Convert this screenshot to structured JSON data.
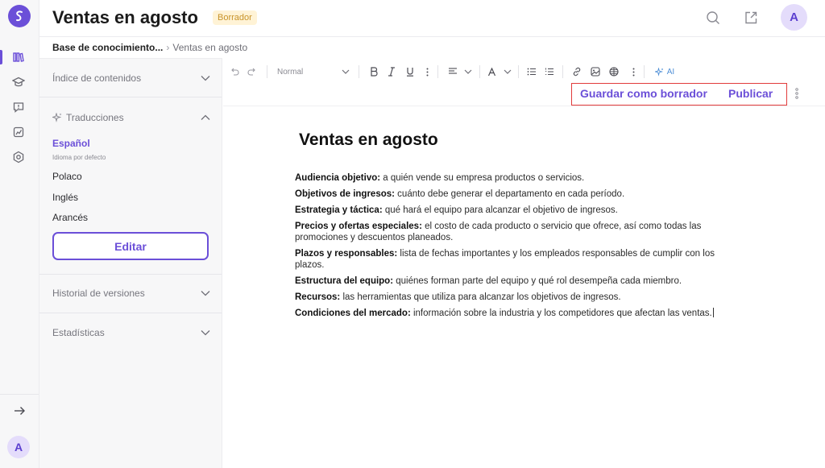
{
  "header": {
    "title": "Ventas en agosto",
    "status": "Borrador",
    "avatar": "A"
  },
  "breadcrumb": {
    "parent": "Base de conocimiento...",
    "current": "Ventas en agosto"
  },
  "rail": {
    "avatar": "A"
  },
  "panel": {
    "toc_label": "Índice de contenidos",
    "translations_label": "Traducciones",
    "languages": [
      {
        "name": "Español",
        "note": "Idioma por defecto"
      },
      {
        "name": "Polaco"
      },
      {
        "name": "Inglés"
      },
      {
        "name": "Arancés"
      }
    ],
    "edit_label": "Editar",
    "history_label": "Historial de versiones",
    "stats_label": "Estadísticas"
  },
  "toolbar": {
    "style_value": "Normal",
    "ai_label": "AI"
  },
  "actions": {
    "save_draft": "Guardar como borrador",
    "publish": "Publicar"
  },
  "document": {
    "title": "Ventas en agosto",
    "paragraphs": [
      {
        "label": "Audiencia objetivo:",
        "text": " a quién vende su empresa productos o servicios."
      },
      {
        "label": "Objetivos de ingresos:",
        "text": " cuánto debe generar el departamento en cada período."
      },
      {
        "label": "Estrategia y táctica:",
        "text": " qué hará el equipo para alcanzar el objetivo de ingresos."
      },
      {
        "label": "Precios y ofertas especiales:",
        "text": " el costo de cada producto o servicio que ofrece, así como todas las promociones y descuentos planeados."
      },
      {
        "label": "Plazos y responsables:",
        "text": " lista de fechas importantes y los empleados responsables de cumplir con los plazos."
      },
      {
        "label": "Estructura del equipo:",
        "text": " quiénes forman parte del equipo y qué rol desempeña cada miembro."
      },
      {
        "label": "Recursos:",
        "text": " las herramientas que utiliza para alcanzar los objetivos de ingresos."
      },
      {
        "label": "Condiciones del mercado:",
        "text": " información sobre la industria y los competidores que afectan las ventas."
      }
    ]
  },
  "colors": {
    "accent": "#6b4fd8",
    "highlight_border": "#e23b3b",
    "badge_bg": "#fff3d6",
    "badge_text": "#c8932a"
  }
}
